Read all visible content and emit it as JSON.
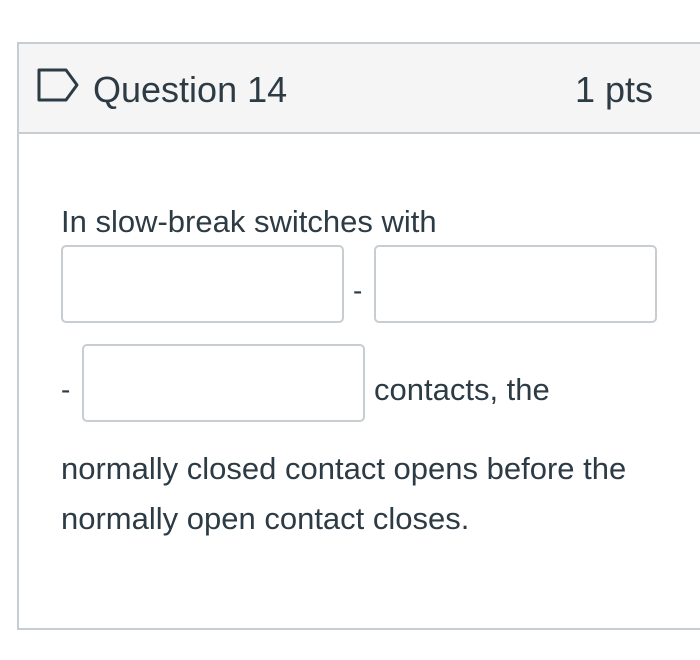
{
  "question": {
    "title": "Question 14",
    "points": "1 pts",
    "flag_icon": "flag-outline-icon"
  },
  "body": {
    "line1": "In slow-break switches with",
    "separator1": "-",
    "separator2": "-",
    "after_blanks": "contacts, the",
    "line3": "normally closed contact opens before the",
    "line4": "normally open contact closes."
  },
  "blanks": [
    {
      "value": "",
      "placeholder": ""
    },
    {
      "value": "",
      "placeholder": ""
    },
    {
      "value": "",
      "placeholder": ""
    }
  ],
  "colors": {
    "text": "#2d3b45",
    "border": "#c7cdd1",
    "header_bg": "#f5f5f5",
    "flag": "#2d3b45"
  }
}
